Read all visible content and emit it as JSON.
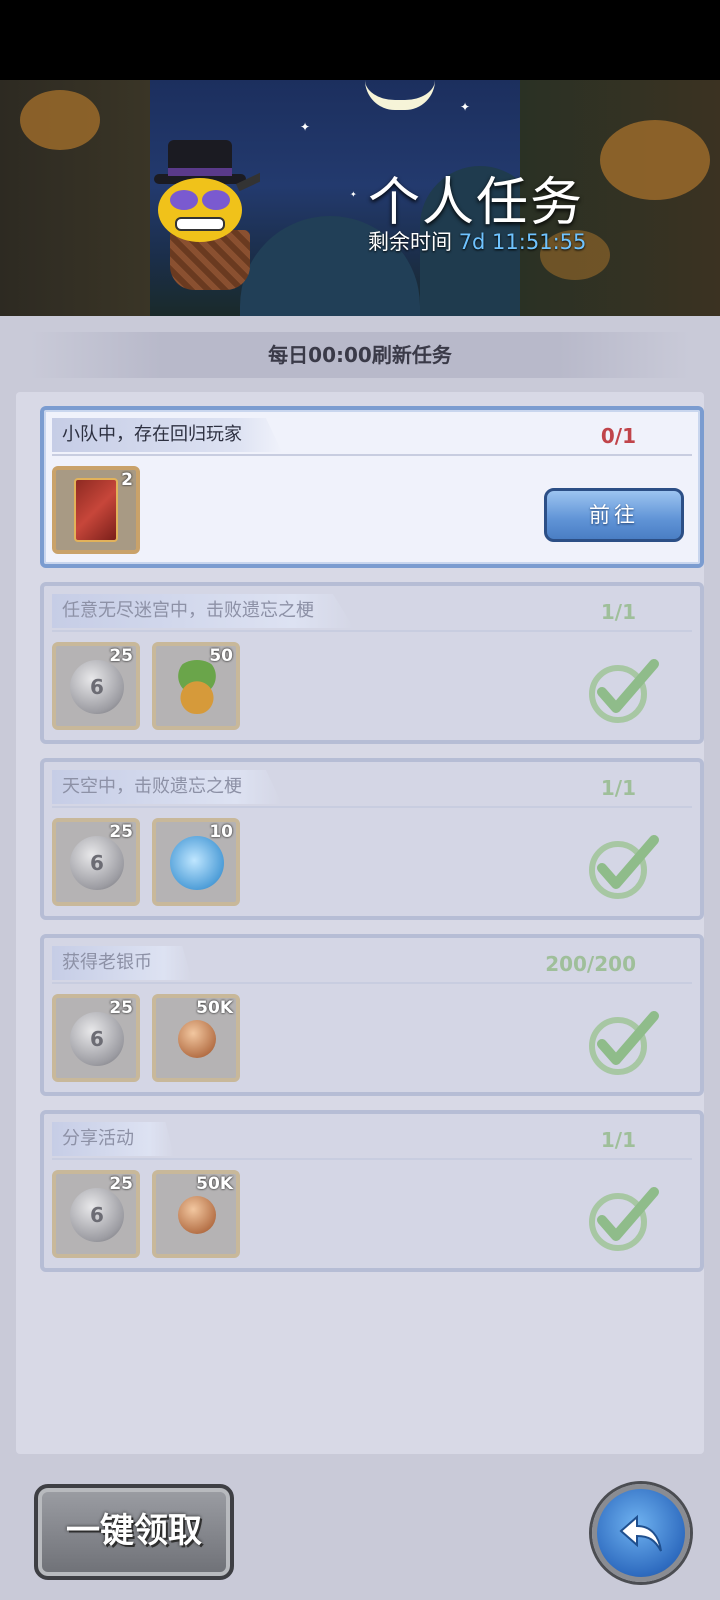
{
  "banner": {
    "title": "个人任务",
    "timer_label": "剩余时间",
    "timer_value": "7d 11:51:55"
  },
  "refresh_notice": "每日00:00刷新任务",
  "tasks": [
    {
      "name": "小队中，存在回归玩家",
      "progress": "0/1",
      "state": "in-progress",
      "action_label": "前往",
      "rewards": [
        {
          "icon": "red-card-item-icon",
          "qty": "2"
        }
      ]
    },
    {
      "name": "任意无尽迷宫中，击败遗忘之梗",
      "progress": "1/1",
      "state": "completed",
      "rewards": [
        {
          "icon": "silver-coin-icon",
          "qty": "25"
        },
        {
          "icon": "plant-fruit-icon",
          "qty": "50"
        }
      ]
    },
    {
      "name": "天空中，击败遗忘之梗",
      "progress": "1/1",
      "state": "completed",
      "rewards": [
        {
          "icon": "silver-coin-icon",
          "qty": "25"
        },
        {
          "icon": "blue-slime-icon",
          "qty": "10"
        }
      ]
    },
    {
      "name": "获得老银币",
      "progress": "200/200",
      "state": "completed",
      "rewards": [
        {
          "icon": "silver-coin-icon",
          "qty": "25"
        },
        {
          "icon": "copper-coin-icon",
          "qty": "50K"
        }
      ]
    },
    {
      "name": "分享活动",
      "progress": "1/1",
      "state": "completed",
      "rewards": [
        {
          "icon": "silver-coin-icon",
          "qty": "25"
        },
        {
          "icon": "copper-coin-icon",
          "qty": "50K"
        }
      ]
    }
  ],
  "silver_coin_glyph": "6",
  "claim_all_label": "一键领取",
  "colors": {
    "progress_incomplete": "#c0444a",
    "progress_complete": "#9fbf9a",
    "timer_value": "#6fc3ff",
    "go_button": "#5f93d6"
  }
}
